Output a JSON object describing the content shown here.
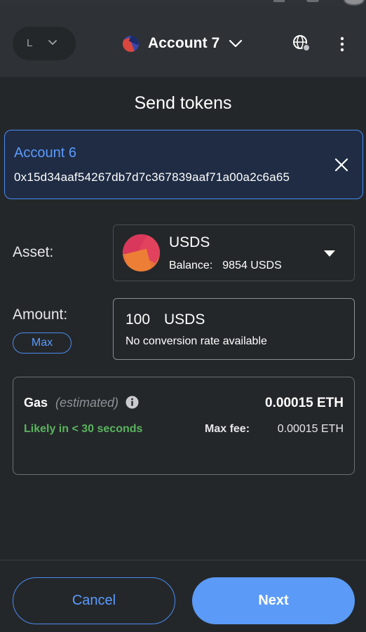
{
  "header": {
    "network_letter": "L",
    "account_name": "Account 7"
  },
  "page": {
    "title": "Send tokens"
  },
  "recipient": {
    "name": "Account 6",
    "address": "0x15d34aaf54267db7d7c367839aaf71a00a2c6a65"
  },
  "asset": {
    "label": "Asset:",
    "symbol": "USDS",
    "balance_label": "Balance:",
    "balance_value": "9854 USDS"
  },
  "amount": {
    "label": "Amount:",
    "value": "100",
    "unit": "USDS",
    "conversion_note": "No conversion rate available",
    "max_label": "Max"
  },
  "gas": {
    "title": "Gas",
    "estimated": "(estimated)",
    "amount": "0.00015 ETH",
    "time": "Likely in < 30 seconds",
    "max_fee_label": "Max fee:",
    "max_fee_value": "0.00015 ETH"
  },
  "footer": {
    "cancel_label": "Cancel",
    "next_label": "Next"
  },
  "colors": {
    "background": "#24272a",
    "header": "#2e3135",
    "accent": "#5b9bf7",
    "success": "#5ab45f"
  }
}
